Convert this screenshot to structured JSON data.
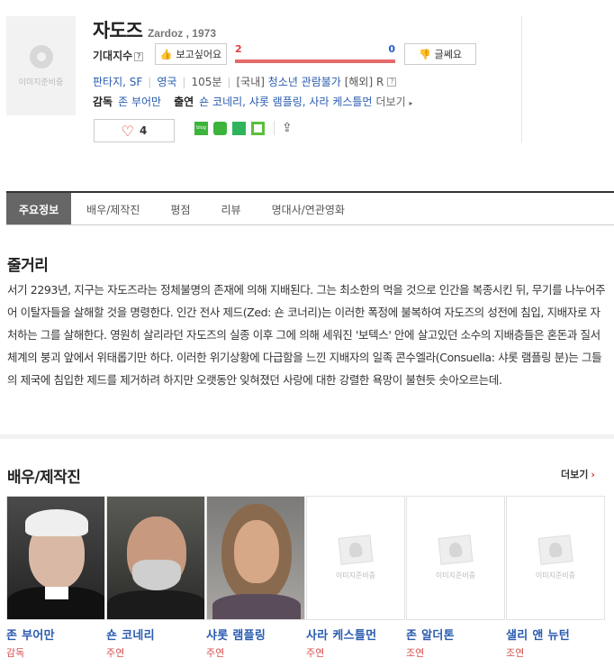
{
  "movie": {
    "title": "자도즈",
    "original_title": "Zardoz , 1973",
    "poster_placeholder": "이미지준비중"
  },
  "expect": {
    "label": "기대지수",
    "want_label": "보고싶어요",
    "meh_label": "글쎄요",
    "want_count": "2",
    "meh_count": "0"
  },
  "info": {
    "genre": "판타지, SF",
    "country": "영국",
    "runtime": "105분",
    "rating_prefix": "[국내]",
    "rating": "청소년 관람불가",
    "overseas_prefix": "[해외]",
    "overseas_rating": "R"
  },
  "credits": {
    "director_label": "감독",
    "director": "존 부어만",
    "cast_label": "출연",
    "cast": "숀 코네리, 샤롯 램플링, 사라 케스틀먼",
    "more": "더보기"
  },
  "like": {
    "count": "4"
  },
  "share": {
    "blog_label": "blog"
  },
  "tabs": [
    "주요정보",
    "배우/제작진",
    "평점",
    "리뷰",
    "명대사/연관영화"
  ],
  "synopsis": {
    "heading": "줄거리",
    "text": "서기 2293년, 지구는 자도즈라는 정체불명의 존재에 의해 지배된다. 그는 최소한의 먹을 것으로 인간을 복종시킨 뒤, 무기를 나누어주어 이탈자들을 살해할 것을 명령한다. 인간 전사 제드(Zed: 숀 코너리)는 이러한 폭정에 불복하여 자도즈의 성전에 침입, 지배자로 자처하는 그를 살해한다. 영원히 살리라던 자도즈의 실종 이후 그에 의해 세워진 '보텍스' 안에 살고있던 소수의 지배층들은 혼돈과 질서체계의 붕괴 앞에서 위태롭기만 하다. 이러한 위기상황에 다급함을 느낀 지배자의 일족 콘수엘라(Consuella: 샤롯 램플링 분)는 그들의 제국에 침입한 제드를 제거하려 하지만 오랫동안 잊혀졌던 사랑에 대한 강렬한 욕망이 불현듯 솟아오르는데."
  },
  "cast_section": {
    "heading": "배우/제작진",
    "more": "더보기",
    "placeholder": "이미지준비중",
    "people": [
      {
        "name": "존 부어만",
        "role": "감독",
        "photo": "white-haired-man"
      },
      {
        "name": "숀 코네리",
        "role": "주연",
        "photo": "bearded-man"
      },
      {
        "name": "샤롯 램플링",
        "role": "주연",
        "photo": "woman"
      },
      {
        "name": "사라 케스틀먼",
        "role": "주연",
        "photo": "placeholder"
      },
      {
        "name": "존 알더톤",
        "role": "조연",
        "photo": "placeholder"
      },
      {
        "name": "샐리 앤 뉴턴",
        "role": "조연",
        "photo": "placeholder"
      }
    ]
  },
  "colors": {
    "link": "#2a5cb0",
    "like_bar": "#e56a6a",
    "role": "#d85050"
  }
}
